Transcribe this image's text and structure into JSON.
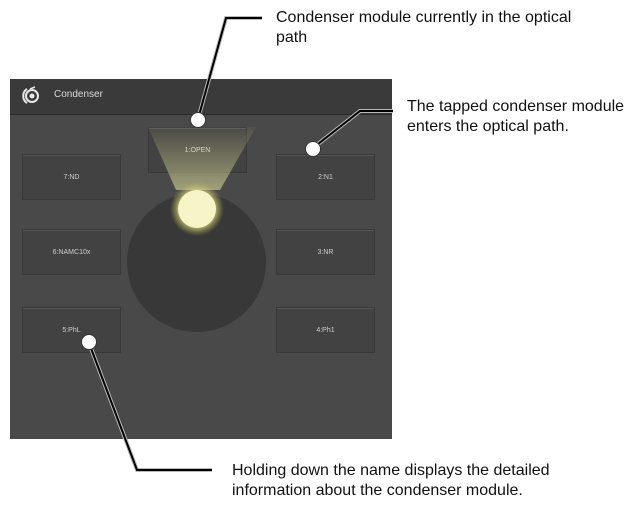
{
  "window": {
    "title": "Condenser",
    "icon": "condenser-icon"
  },
  "modules": [
    {
      "label": "1:OPEN",
      "state": "in-optical-path"
    },
    {
      "label": "2:N1"
    },
    {
      "label": "3:NR"
    },
    {
      "label": "4:Ph1"
    },
    {
      "label": "5:PhL"
    },
    {
      "label": "6:NAMC10x"
    },
    {
      "label": "7:ND"
    }
  ],
  "callouts": {
    "current_module": "Condenser module currently in the optical path",
    "tapped_module": "The tapped condenser module enters the optical path.",
    "hold_name": "Holding down the name displays the detailed information about the condenser module."
  },
  "colors": {
    "panel": "#494949",
    "titlebar": "#3a3a3a",
    "button": "#424242",
    "turret": "#383838",
    "light": "#f5f3b8"
  }
}
